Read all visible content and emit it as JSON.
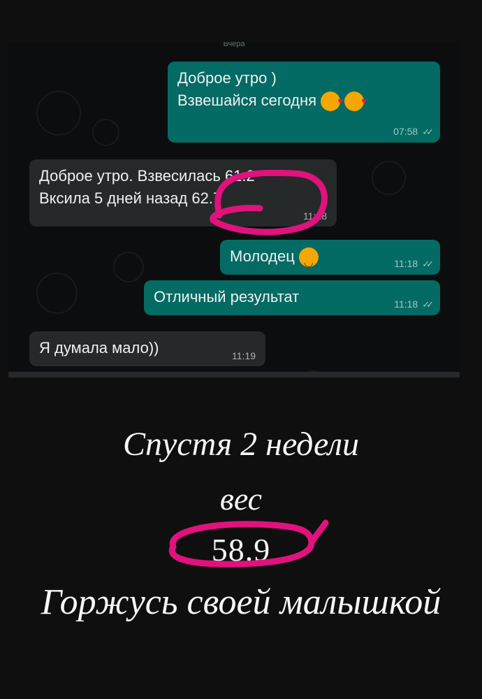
{
  "chat": {
    "date_label": "Вчера",
    "messages": [
      {
        "direction": "outgoing",
        "line1": "Доброе утро )",
        "line2": "Взвешайся сегодня",
        "time": "07:58",
        "emoji": [
          "kiss-emoji",
          "kiss-emoji"
        ]
      },
      {
        "direction": "incoming",
        "line1": "Доброе утро. Взвесилась 61.2",
        "line2": "Вксила 5 дней назад 62.7",
        "time": "11:18"
      },
      {
        "direction": "outgoing",
        "text": "Молодец",
        "time": "11:18",
        "emoji": [
          "smile-emoji"
        ]
      },
      {
        "direction": "outgoing",
        "text": "Отличный результат",
        "time": "11:18"
      },
      {
        "direction": "incoming",
        "text": "Я думала мало))",
        "time": "11:19"
      }
    ]
  },
  "caption": {
    "line1": "Спустя 2 недели",
    "line2": "вес",
    "weight": "58.9",
    "line4": "Горжусь своей малышкой"
  },
  "colors": {
    "outgoing_bubble": "#046a64",
    "incoming_bubble": "#25292a",
    "highlight_marker": "#e0127c"
  }
}
